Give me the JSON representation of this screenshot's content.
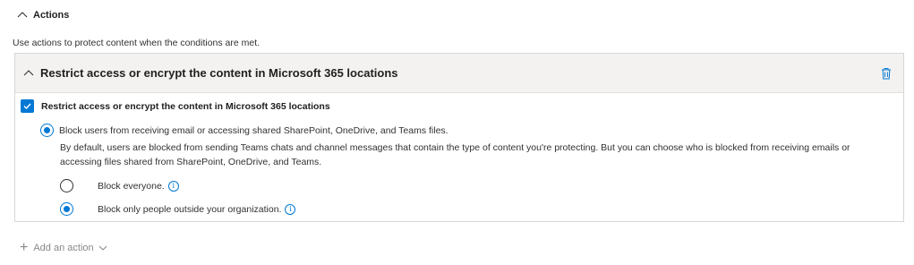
{
  "section": {
    "title": "Actions",
    "icon": "chevron-up-icon"
  },
  "description": "Use actions to protect content when the conditions are met.",
  "card": {
    "title": "Restrict access or encrypt the content in Microsoft 365 locations",
    "delete_icon": "trash-icon",
    "checkbox_label": "Restrict access or encrypt the content in Microsoft 365 locations",
    "checkbox_checked": true,
    "main_radio_label": "Block users from receiving email or accessing shared SharePoint, OneDrive, and Teams files.",
    "main_radio_selected": true,
    "explanation": "By default, users are blocked from sending Teams chats and channel messages that contain the type of content you're protecting. But you can choose who is blocked from receiving emails or accessing files shared from SharePoint, OneDrive, and Teams.",
    "options": [
      {
        "label": "Block everyone.",
        "selected": false,
        "info_icon": "info-icon"
      },
      {
        "label": "Block only people outside your organization.",
        "selected": true,
        "info_icon": "info-icon"
      }
    ]
  },
  "add_action": {
    "label": "Add an action"
  },
  "colors": {
    "accent": "#0078d4",
    "header_bg": "#f3f2f1",
    "border": "#d6d6d6"
  }
}
